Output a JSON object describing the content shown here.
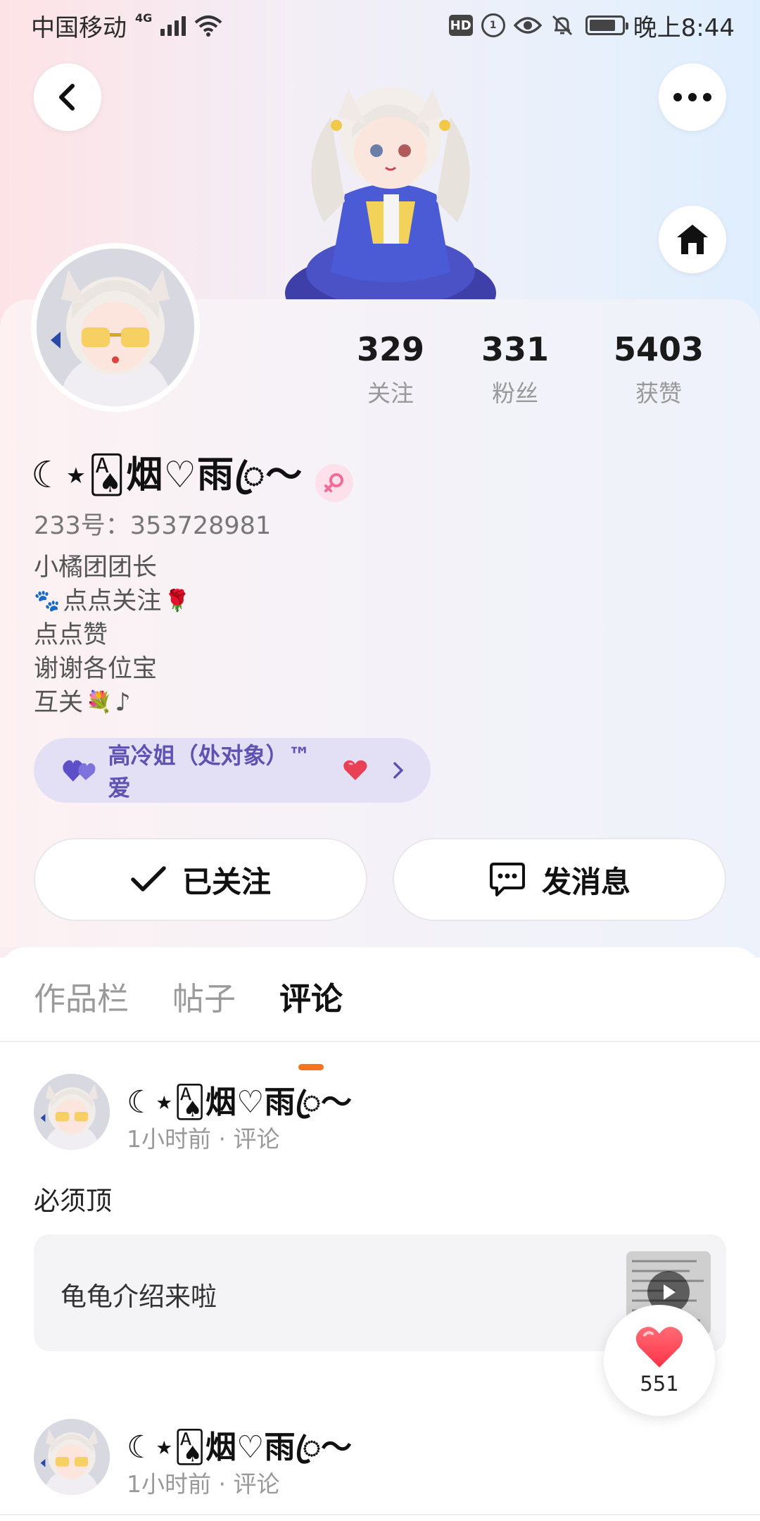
{
  "status_bar": {
    "carrier": "中国移动",
    "network": "4G",
    "hd": "HD",
    "time": "晚上8:44"
  },
  "stats": [
    {
      "value": "329",
      "label": "关注"
    },
    {
      "value": "331",
      "label": "粉丝"
    },
    {
      "value": "5403",
      "label": "获赞"
    }
  ],
  "profile": {
    "username": "☾⋆🂡烟♡雨ꦿ︎〜",
    "uid": "233号：353728981",
    "gender_icon": "female-icon",
    "bio": {
      "line1": "小橘团团长",
      "line2": "点点关注",
      "line3": "点点赞",
      "line4": "谢谢各位宝",
      "line5": "互关",
      "line5_suffix": "♪",
      "emoji_paw": "🐾",
      "emoji_rose": "🌹",
      "emoji_bouquet": "💐"
    },
    "group_label": "高冷姐（处对象）™爱"
  },
  "actions": {
    "follow_label": "已关注",
    "message_label": "发消息"
  },
  "tabs": [
    {
      "label": "作品栏",
      "active": false
    },
    {
      "label": "帖子",
      "active": false
    },
    {
      "label": "评论",
      "active": true
    }
  ],
  "comments": [
    {
      "author": "☾⋆🂡烟♡雨ꦿ︎〜",
      "meta": "1小时前 · 评论",
      "text": "必须顶",
      "quote": "龟龟介绍来啦"
    },
    {
      "author": "☾⋆🂡烟♡雨ꦿ︎〜",
      "meta": "1小时前 · 评论"
    }
  ],
  "like_fab": {
    "count": "551"
  },
  "colors": {
    "accent": "#f5751f",
    "group_text": "#5f52b0",
    "group_bg": "#e3e0f6",
    "like_heart": "#ff4d5e"
  }
}
